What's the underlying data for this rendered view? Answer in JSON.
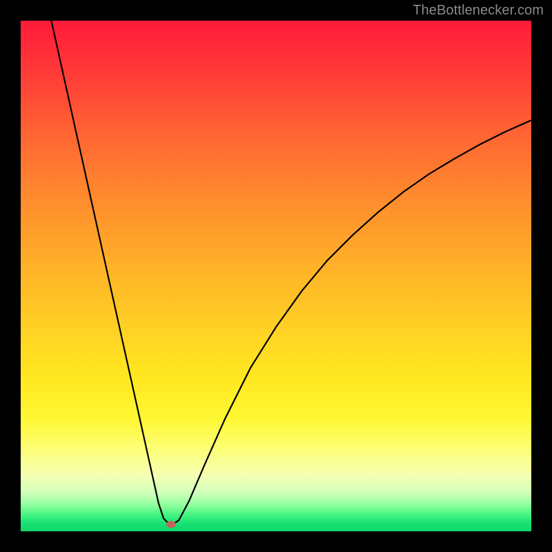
{
  "watermark": "TheBottlenecker.com",
  "colors": {
    "frame": "#000000",
    "curve": "#000000",
    "dot": "#c5645a",
    "gradient": [
      "#ff1a39",
      "#ff3a38",
      "#ff6433",
      "#ff8c2e",
      "#ffb128",
      "#ffd024",
      "#ffe820",
      "#fff733",
      "#fdff78",
      "#f6ffb2",
      "#d0ffba",
      "#8bff9c",
      "#3cf27f",
      "#19e072",
      "#0fd96d"
    ]
  },
  "chart_data": {
    "type": "line",
    "title": "",
    "xlabel": "",
    "ylabel": "",
    "xlim": [
      0,
      100
    ],
    "ylim": [
      0,
      100
    ],
    "grid": false,
    "legend": false,
    "note": "Axes are unlabeled; values normalized 0–100. y=0 is plot bottom, y=100 is plot top.",
    "series": [
      {
        "name": "bottleneck-curve",
        "x": [
          6,
          8,
          10,
          12,
          14,
          16,
          18,
          20,
          22,
          24,
          26,
          27,
          28,
          29,
          30,
          31,
          33,
          36,
          40,
          45,
          50,
          55,
          60,
          65,
          70,
          75,
          80,
          85,
          90,
          95,
          100
        ],
        "y": [
          100,
          91,
          82,
          73,
          64,
          55,
          46,
          37,
          28,
          19,
          10,
          5.5,
          2.5,
          1.5,
          1.5,
          2.2,
          6,
          13,
          22,
          32,
          40,
          47,
          53,
          58,
          62.5,
          66.5,
          70,
          73,
          75.8,
          78.3,
          80.5
        ]
      }
    ],
    "marker": {
      "x": 29.5,
      "y": 1.3,
      "shape": "ellipse",
      "color": "#c5645a"
    }
  }
}
